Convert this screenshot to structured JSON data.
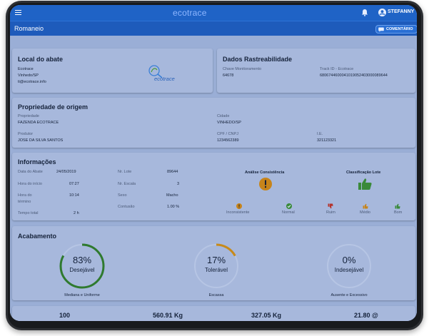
{
  "app": {
    "logo_text": "ecotrace",
    "user_name": "STEFANNY",
    "page_title": "Romaneio",
    "comment_button": "COMENTÁRIO",
    "colors": {
      "primary": "#1f63c6",
      "green": "#3a8a3a",
      "orange": "#c78a1a",
      "red": "#b5322b"
    }
  },
  "local_abate": {
    "title": "Local do abate",
    "lines": [
      "Ecotrace",
      "Vinhedo/SP",
      "ti@ecotrace.info"
    ],
    "logo_text": "ecotrace"
  },
  "rastreabilidade": {
    "title": "Dados Rastreabilidade",
    "chave_label": "Chave Monitoramento",
    "chave_value": "64678",
    "track_label": "Track ID - Ecotrace",
    "track_value": "6806744600041019052403000089644"
  },
  "propriedade": {
    "title": "Propriedade de origem",
    "propriedade_label": "Propriedade",
    "propriedade_value": "FAZENDA ECOTRACE",
    "cidade_label": "Cidade",
    "cidade_value": "VINHEDO/SP",
    "produtor_label": "Produtor",
    "produtor_value": "JOSE DA SILVA SANTOS",
    "cpf_label": "CPF / CNPJ",
    "cpf_value": "1234562389",
    "ie_label": "I.E.",
    "ie_value": "321123321"
  },
  "informacoes": {
    "title": "Informações",
    "data_abate_label": "Data do Abate",
    "data_abate_value": "24/05/2019",
    "hora_inicio_label": "Hora do início",
    "hora_inicio_value": "07:27",
    "hora_termino_label_1": "Hora do",
    "hora_termino_label_2": "término",
    "hora_termino_value": "10:14",
    "tempo_total_label": "Tempo total",
    "tempo_total_value": "2 h",
    "nr_lote_label": "Nr. Lote",
    "nr_lote_value": "89644",
    "nr_escala_label": "Nr. Escala",
    "nr_escala_value": "3",
    "sexo_label": "Sexo",
    "sexo_value": "Macho",
    "contusao_label": "Contusão",
    "contusao_value": "1.00 %",
    "consistencia_title": "Análise Consistência",
    "consistencia_options": [
      "Inconsistente",
      "Normal"
    ],
    "classificacao_title": "Classificação Lote",
    "classificacao_options": [
      "Ruim",
      "Médio",
      "Bom"
    ]
  },
  "acabamento": {
    "title": "Acabamento",
    "gauges": [
      {
        "percent": 83,
        "percent_text": "83%",
        "label": "Desejável",
        "caption": "Mediana e Uniforme",
        "color": "#2f7a2f"
      },
      {
        "percent": 17,
        "percent_text": "17%",
        "label": "Tolerável",
        "caption": "Escassa",
        "color": "#c78a1a"
      },
      {
        "percent": 0,
        "percent_text": "0%",
        "label": "Indesejável",
        "caption": "Ausente e Excessivo",
        "color": "#b5322b"
      }
    ]
  },
  "totals": [
    "100",
    "560.91 Kg",
    "327.05 Kg",
    "21.80 @"
  ]
}
